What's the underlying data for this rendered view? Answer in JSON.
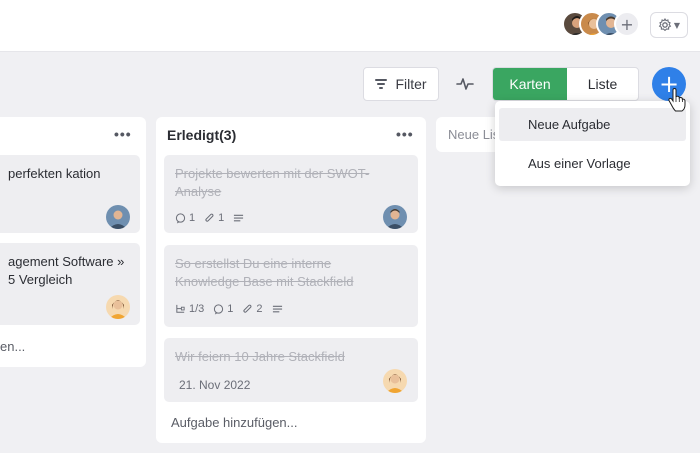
{
  "header": {
    "avatars": [
      "user-1",
      "user-2",
      "user-3"
    ],
    "add_member_label": "+",
    "settings_icon": "gear-icon"
  },
  "toolbar": {
    "filter_label": "Filter",
    "view_karten_label": "Karten",
    "view_liste_label": "Liste",
    "add_label": "+",
    "accent_green": "#3aa661",
    "accent_blue": "#2f80e8"
  },
  "columns": {
    "left": {
      "cards": [
        {
          "title": "perfekten kation"
        },
        {
          "title": "agement Software » 5 Vergleich"
        }
      ],
      "add_task": "en..."
    },
    "middle": {
      "title": "Erledigt(3)",
      "cards": [
        {
          "title": "Projekte bewerten mit der SWOT-Analyse",
          "comments": "1",
          "attachments": "1"
        },
        {
          "title": "So erstellst Du eine interne Knowledge Base mit Stackfield",
          "subtasks": "1/3",
          "comments": "1",
          "attachments": "2"
        },
        {
          "title": "Wir feiern 10 Jahre Stackfield",
          "date": "21. Nov 2022"
        }
      ],
      "add_task": "Aufgabe hinzufügen..."
    },
    "right": {
      "title": "Neue Liste"
    }
  },
  "dropdown": {
    "items": [
      "Neue Aufgabe",
      "Aus einer Vorlage"
    ]
  }
}
